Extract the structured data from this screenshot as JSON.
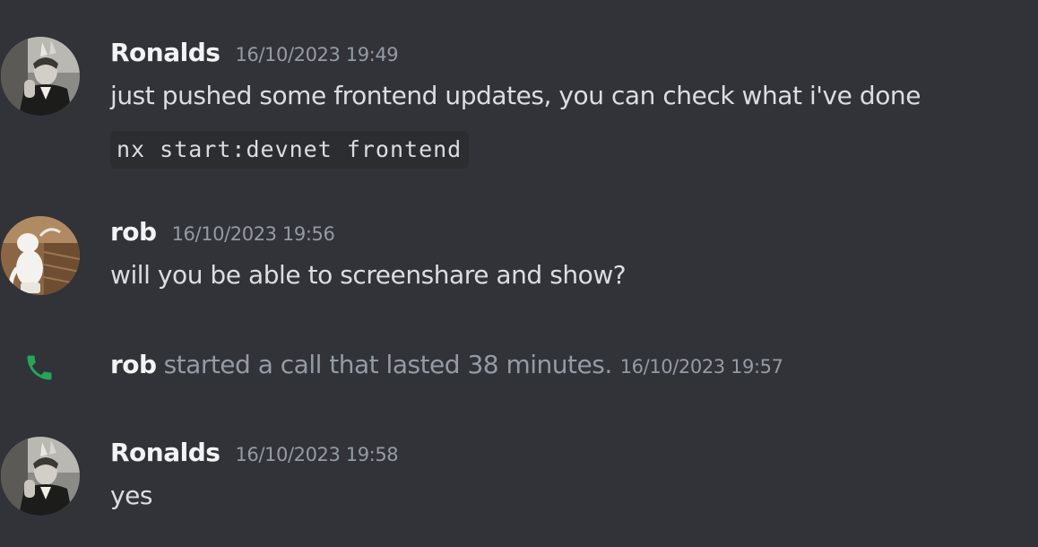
{
  "messages": [
    {
      "author": "Ronalds",
      "timestamp": "16/10/2023 19:49",
      "text": "just pushed some frontend updates, you can check what i've done",
      "code": "nx start:devnet frontend",
      "avatar": "ronalds-avatar"
    },
    {
      "author": "rob",
      "timestamp": "16/10/2023 19:56",
      "text": "will you be able to screenshare and show?",
      "avatar": "rob-avatar"
    },
    {
      "author": "Ronalds",
      "timestamp": "16/10/2023 19:58",
      "text": "yes",
      "avatar": "ronalds-avatar"
    }
  ],
  "call_event": {
    "user": "rob",
    "text": "started a call that lasted 38 minutes.",
    "timestamp": "16/10/2023 19:57",
    "icon": "phone-icon"
  },
  "colors": {
    "background": "#313338",
    "code_background": "#2b2d31",
    "username": "#f2f3f5",
    "message_text": "#dbdee1",
    "muted": "#949ba4",
    "call_green": "#23a55a"
  }
}
